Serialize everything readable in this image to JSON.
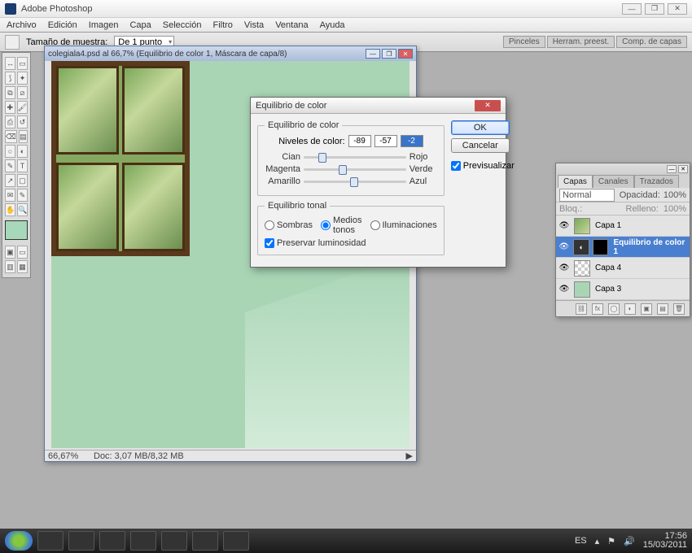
{
  "app": {
    "title": "Adobe Photoshop"
  },
  "menu": [
    "Archivo",
    "Edición",
    "Imagen",
    "Capa",
    "Selección",
    "Filtro",
    "Vista",
    "Ventana",
    "Ayuda"
  ],
  "optionbar": {
    "sample_label": "Tamaño de muestra:",
    "sample_value": "De 1 punto",
    "right_tabs": [
      "Pinceles",
      "Herram. preest.",
      "Comp. de capas"
    ]
  },
  "document": {
    "title": "colegiala4.psd al 66,7% (Equilibrio de color 1, Máscara de capa/8)",
    "zoom": "66,67%",
    "docinfo": "Doc: 3,07 MB/8,32 MB"
  },
  "dialog": {
    "title": "Equilibrio de color",
    "ok": "OK",
    "cancel": "Cancelar",
    "preview": "Previsualizar",
    "group1": "Equilibrio de color",
    "levels_label": "Niveles de color:",
    "levels": [
      "-89",
      "-57",
      "-2"
    ],
    "sliders": [
      {
        "left": "Cian",
        "right": "Rojo",
        "pos": 18
      },
      {
        "left": "Magenta",
        "right": "Verde",
        "pos": 38
      },
      {
        "left": "Amarillo",
        "right": "Azul",
        "pos": 49
      }
    ],
    "group2": "Equilibrio tonal",
    "tones": {
      "shadows": "Sombras",
      "mid": "Medios tonos",
      "high": "Iluminaciones"
    },
    "preserve": "Preservar luminosidad"
  },
  "layers_panel": {
    "tabs": [
      "Capas",
      "Canales",
      "Trazados"
    ],
    "blend_mode": "Normal",
    "opacity_label": "Opacidad:",
    "opacity_value": "100%",
    "lock_label": "Bloq.:",
    "fill_label": "Relleno:",
    "fill_value": "100%",
    "layers": [
      {
        "name": "Capa 1",
        "type": "img"
      },
      {
        "name": "Equilibrio de color 1",
        "type": "adj",
        "active": true
      },
      {
        "name": "Capa 4",
        "type": "chk"
      },
      {
        "name": "Capa 3",
        "type": "grn"
      }
    ]
  },
  "taskbar": {
    "lang": "ES",
    "time": "17:56",
    "date": "15/03/2011"
  }
}
